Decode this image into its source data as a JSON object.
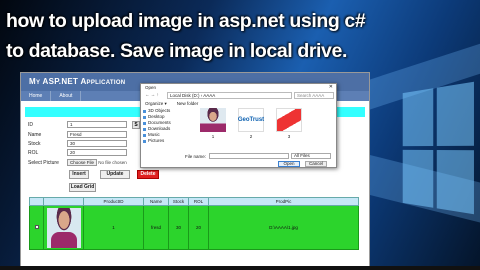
{
  "overlay": {
    "title_line1": "how to upload image in asp.net using c#",
    "title_line2": "to database. Save image in local drive."
  },
  "app": {
    "header_title": "My ASP.NET Application",
    "nav": [
      "Home",
      "About"
    ]
  },
  "form": {
    "id_label": "ID",
    "id_value": "1",
    "name_label": "Name",
    "name_value": "Fresd",
    "stock_label": "Stock",
    "stock_value": "30",
    "rol_label": "ROL",
    "rol_value": "20",
    "picture_label": "Select Picture",
    "choose_file_label": "Choose File",
    "no_file_text": "No file chosen",
    "side_button_label": "S",
    "insert_label": "Insert",
    "update_label": "Update",
    "delete_label": "Delete",
    "load_grid_label": "Load Grid"
  },
  "grid": {
    "headers": [
      "",
      "",
      "ProductID",
      "Name",
      "Stock",
      "ROL",
      "ProdPic"
    ],
    "row": {
      "id": "1",
      "name": "fresd",
      "stock": "30",
      "rol": "20",
      "pic": "D:\\AAAA\\1.jpg"
    }
  },
  "dialog": {
    "title": "Open",
    "path": "Local Disk (D:)  ›  AAAA",
    "search_placeholder": "Search AAAA",
    "organize_label": "Organize ▾",
    "new_folder_label": "New folder",
    "nav_items": [
      "3D Objects",
      "Desktop",
      "Documents",
      "Downloads",
      "Music",
      "Pictures"
    ],
    "files": [
      {
        "name": "1",
        "thumb": "person-photo"
      },
      {
        "name": "2",
        "thumb": "geotrust-logo",
        "logo_text": "GeoTrust"
      },
      {
        "name": "3",
        "thumb": "red-card"
      }
    ],
    "filename_label": "File name:",
    "filter_value": "All Files",
    "open_label": "Open",
    "cancel_label": "Cancel"
  }
}
